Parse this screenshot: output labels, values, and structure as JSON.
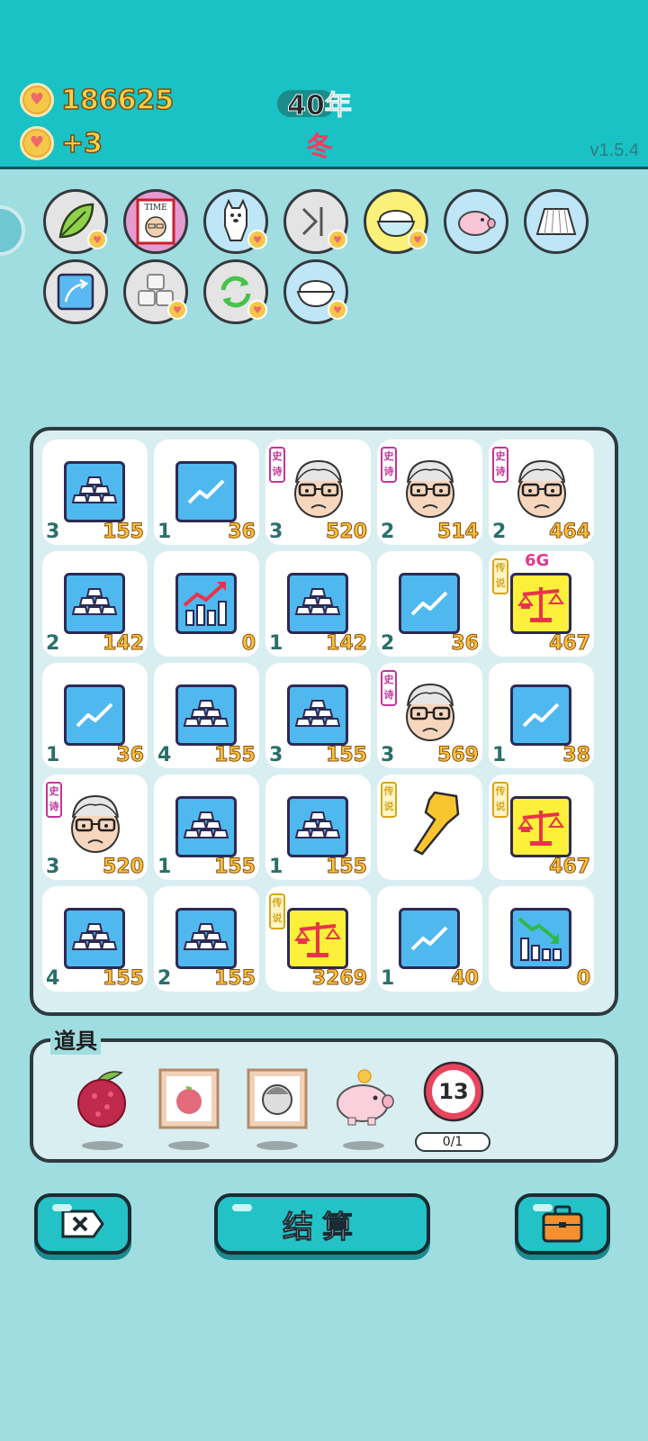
{
  "header": {
    "coins": "186625",
    "coin_rate": "+3",
    "year": "40年",
    "season": "冬",
    "version": "v1.5.4"
  },
  "skills": [
    {
      "name": "leaf",
      "icon": "leaf-icon"
    },
    {
      "name": "time-magazine",
      "icon": "time-magazine-icon"
    },
    {
      "name": "dog",
      "icon": "dog-icon"
    },
    {
      "name": "skip",
      "icon": "skip-icon"
    },
    {
      "name": "rice-bowl-gold",
      "icon": "rice-bowl-icon"
    },
    {
      "name": "piggy",
      "icon": "piggy-bank-icon"
    },
    {
      "name": "skirt",
      "icon": "skirt-icon"
    },
    {
      "name": "up-arrow",
      "icon": "arrow-up-icon"
    },
    {
      "name": "blocks",
      "icon": "blocks-icon"
    },
    {
      "name": "refresh",
      "icon": "refresh-icon"
    },
    {
      "name": "rice-bowl-blue",
      "icon": "rice-bowl-icon"
    }
  ],
  "board": {
    "tiles": [
      {
        "type": "gold",
        "level": "3",
        "value": "155"
      },
      {
        "type": "trend",
        "level": "1",
        "value": "36"
      },
      {
        "type": "face",
        "tag": "史诗",
        "level": "3",
        "value": "520"
      },
      {
        "type": "face",
        "tag": "史诗",
        "level": "2",
        "value": "514"
      },
      {
        "type": "face",
        "tag": "史诗",
        "level": "2",
        "value": "464"
      },
      {
        "type": "gold",
        "level": "2",
        "value": "142"
      },
      {
        "type": "bars-up",
        "level": "",
        "value": "0"
      },
      {
        "type": "gold",
        "level": "1",
        "value": "142"
      },
      {
        "type": "trend",
        "level": "2",
        "value": "36"
      },
      {
        "type": "scale",
        "tag": "传说",
        "extra": "6G",
        "level": "",
        "value": "467"
      },
      {
        "type": "trend",
        "level": "1",
        "value": "36"
      },
      {
        "type": "gold",
        "level": "4",
        "value": "155"
      },
      {
        "type": "gold",
        "level": "3",
        "value": "155"
      },
      {
        "type": "face",
        "tag": "史诗",
        "level": "3",
        "value": "569"
      },
      {
        "type": "trend",
        "level": "1",
        "value": "38"
      },
      {
        "type": "face",
        "tag": "史诗",
        "level": "3",
        "value": "520"
      },
      {
        "type": "gold",
        "level": "1",
        "value": "155"
      },
      {
        "type": "gold",
        "level": "1",
        "value": "155"
      },
      {
        "type": "hand",
        "tag": "传说",
        "level": "",
        "value": ""
      },
      {
        "type": "scale",
        "tag": "传说",
        "level": "",
        "value": "467"
      },
      {
        "type": "gold",
        "level": "4",
        "value": "155"
      },
      {
        "type": "gold",
        "level": "2",
        "value": "155"
      },
      {
        "type": "scale",
        "tag": "传说",
        "level": "",
        "value": "3269"
      },
      {
        "type": "trend",
        "level": "1",
        "value": "40"
      },
      {
        "type": "bars-down",
        "level": "",
        "value": "0"
      }
    ]
  },
  "items": {
    "title": "道具",
    "list": [
      {
        "name": "lychee",
        "icon": "lychee-icon"
      },
      {
        "name": "lychee-frame",
        "icon": "framed-lychee-icon"
      },
      {
        "name": "portrait-frame",
        "icon": "framed-portrait-icon"
      },
      {
        "name": "piggy-bank",
        "icon": "piggy-bank-icon"
      },
      {
        "name": "counter-13",
        "icon": "target-icon",
        "number": "13",
        "progress": "0/1"
      }
    ]
  },
  "buttons": {
    "exit_icon": "close-icon",
    "settle_label": "结算",
    "bag_icon": "briefcase-icon"
  },
  "colors": {
    "header_bg": "#19c2c4",
    "page_bg": "#9fdde0",
    "coin_text": "#f9d24a",
    "season": "#ef3e62",
    "tile_value": "#f9c23a"
  }
}
